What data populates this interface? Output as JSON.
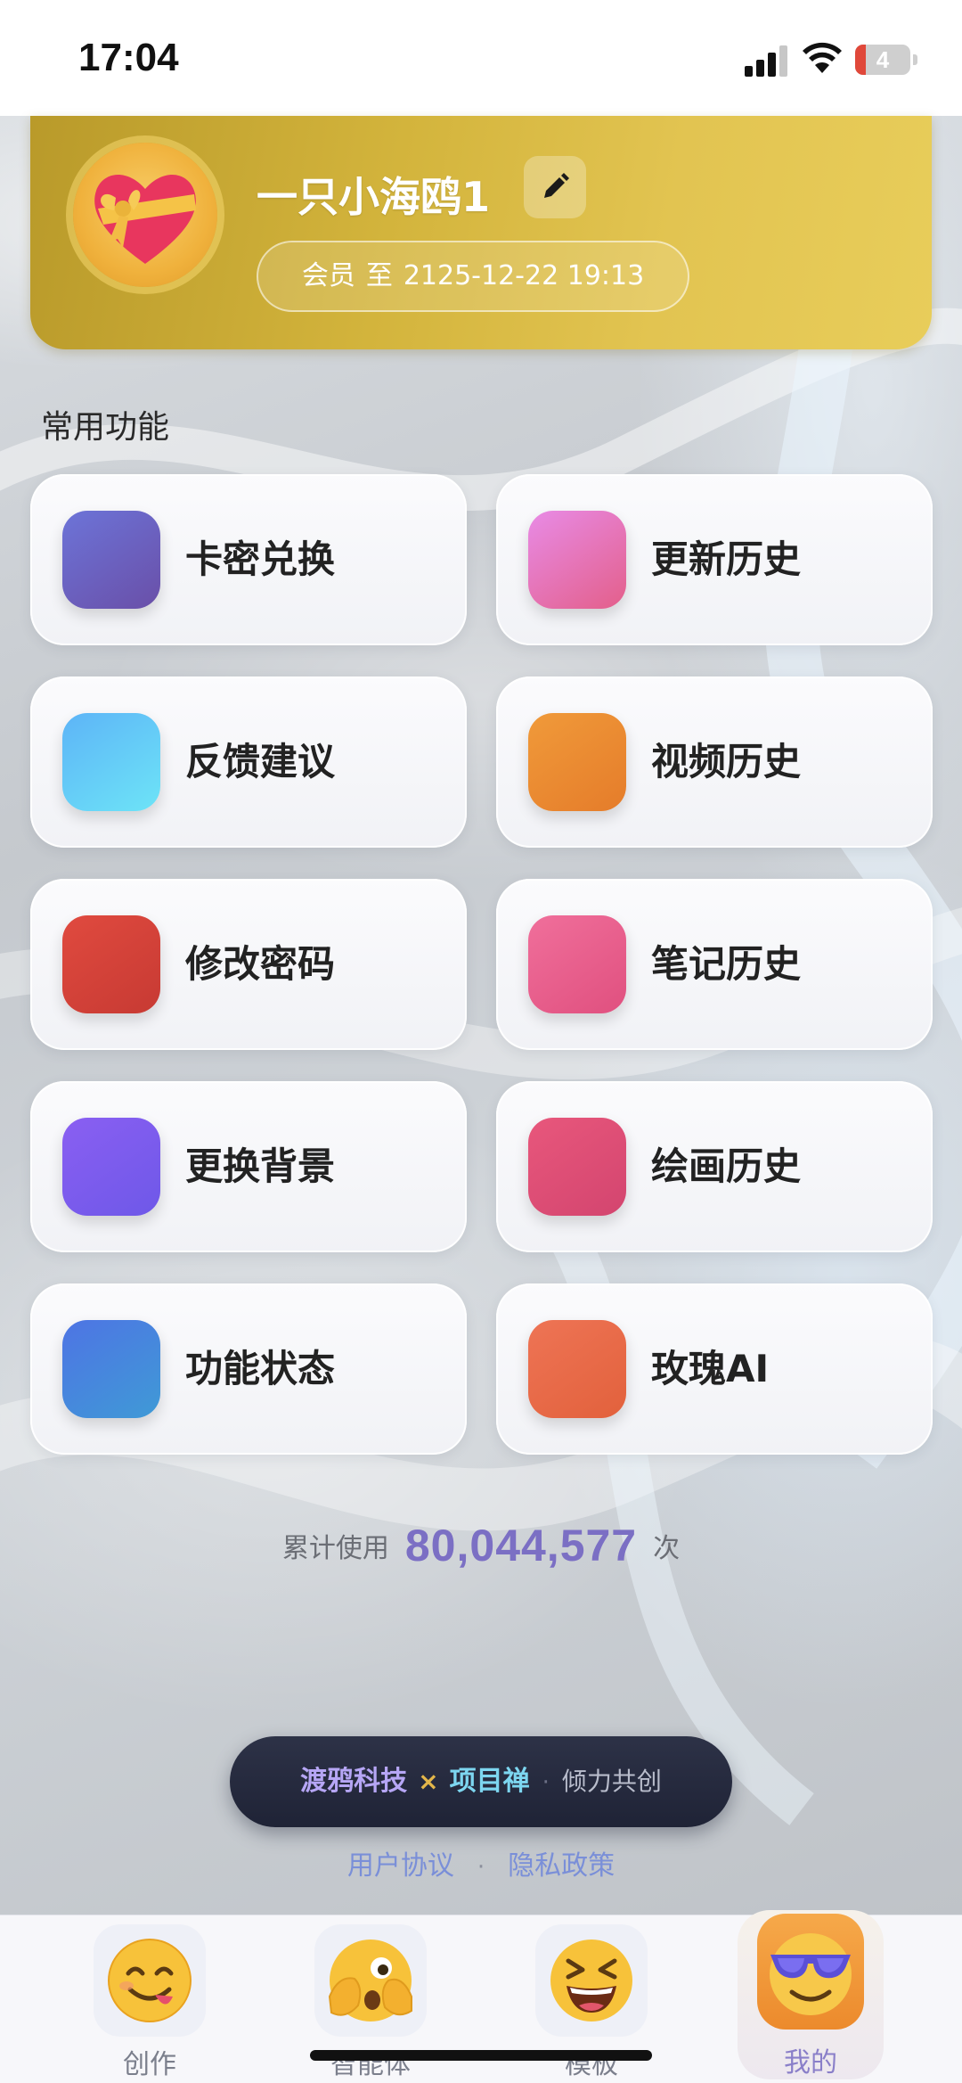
{
  "status_bar": {
    "time": "17:04",
    "battery_level": "4",
    "icons": [
      "signal-icon",
      "wifi-icon",
      "battery-icon"
    ]
  },
  "profile": {
    "username": "一只小海鸥1",
    "avatar_icon": "heart-gift-icon",
    "edit_icon": "pencil-icon",
    "vip_label": "会员",
    "vip_to": "至",
    "vip_expiry": "2125-12-22 19:13"
  },
  "section_title": "常用功能",
  "features": [
    {
      "label": "卡密兑换",
      "color_from": "#6c74d8",
      "color_to": "#6a4fa8"
    },
    {
      "label": "更新历史",
      "color_from": "#e88be6",
      "color_to": "#e35f8a"
    },
    {
      "label": "反馈建议",
      "color_from": "#5db4f7",
      "color_to": "#6de4f7"
    },
    {
      "label": "视频历史",
      "color_from": "#f09a3a",
      "color_to": "#e57c2a"
    },
    {
      "label": "修改密码",
      "color_from": "#e04a3f",
      "color_to": "#c73a33"
    },
    {
      "label": "笔记历史",
      "color_from": "#f06f9b",
      "color_to": "#e0507f"
    },
    {
      "label": "更换背景",
      "color_from": "#8a5ff2",
      "color_to": "#6e58e8"
    },
    {
      "label": "绘画历史",
      "color_from": "#e8577c",
      "color_to": "#d3456f"
    },
    {
      "label": "功能状态",
      "color_from": "#4e74e4",
      "color_to": "#3f9ad6"
    },
    {
      "label": "玫瑰AI",
      "color_from": "#ee7455",
      "color_to": "#e2613c"
    }
  ],
  "usage": {
    "prefix": "累计使用",
    "count": "80,044,577",
    "suffix": "次"
  },
  "brand": {
    "name1": "渡鸦科技",
    "cross": "×",
    "name2": "项目禅",
    "dot": "·",
    "slogan": "倾力共创"
  },
  "links": {
    "terms": "用户协议",
    "separator": "·",
    "privacy": "隐私政策"
  },
  "tabs": [
    {
      "label": "创作",
      "icon": "yum-face-icon"
    },
    {
      "label": "智能体",
      "icon": "peeking-face-icon"
    },
    {
      "label": "模板",
      "icon": "grinning-squint-face-icon"
    },
    {
      "label": "我的",
      "icon": "sunglasses-face-icon",
      "active": true
    }
  ]
}
